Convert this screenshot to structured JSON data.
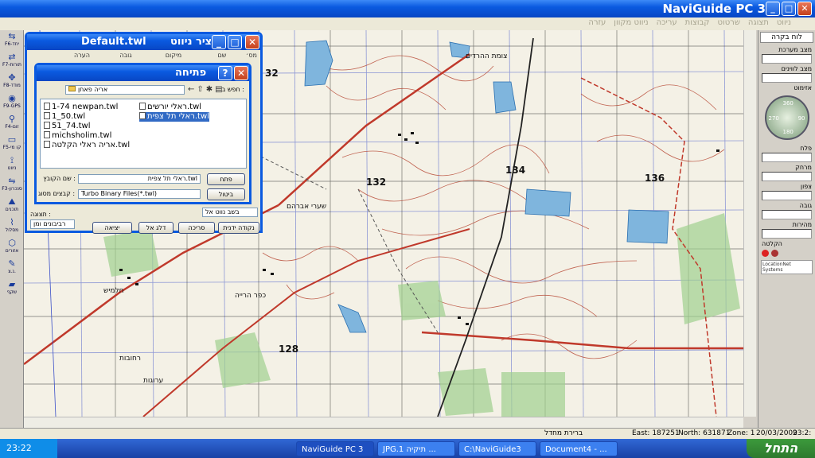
{
  "app": {
    "title": "NaviGuide PC 3"
  },
  "window_buttons": {
    "minimize": "_",
    "maximize": "□",
    "close": "✕"
  },
  "menu": [
    "ניווט",
    "תצוגה",
    "שרטוט",
    "קבוצות",
    "עריכה",
    "ניווט מקוון",
    "עזרה"
  ],
  "left_tools": [
    {
      "label": "F6-יחד",
      "icon": "⇆"
    },
    {
      "label": "F7-תורות",
      "icon": "⇄"
    },
    {
      "label": "F8-מודד",
      "icon": "✥"
    },
    {
      "label": "F9-GPS",
      "icon": "◉"
    },
    {
      "label": "F4-זום",
      "icon": "⚲"
    },
    {
      "label": "F5-קו מי",
      "icon": "▭"
    },
    {
      "label": "ניווט",
      "icon": "⟟"
    },
    {
      "label": "F3-סנכרון",
      "icon": "⇋"
    },
    {
      "label": "תוכנים",
      "icon": "⛰"
    },
    {
      "label": "מסלול",
      "icon": "⌇"
    },
    {
      "label": "אזורים",
      "icon": "⬡"
    },
    {
      "label": "נ.צ.",
      "icon": "✎"
    },
    {
      "label": "שקף",
      "icon": "▰"
    }
  ],
  "right_panel": {
    "header": "לוח בקרה",
    "labels": [
      "מצב מערכת",
      "מצב לווינים",
      "אזימוט",
      "פלח",
      "מרחק",
      "צפון",
      "גובה",
      "מהירות",
      "הקלטה"
    ],
    "compass": {
      "n": "360",
      "e": "90",
      "s": "180",
      "w": "270"
    },
    "logo": "LocationNet Systems"
  },
  "map_labels": [
    "136",
    "134",
    "132",
    "128",
    "32",
    "צומת ההרדים",
    "שערי אברהם",
    "כפר הרייה",
    "חלמיש",
    "ערוגות",
    "רחובות"
  ],
  "default_window": {
    "title": "Default.twl",
    "subtitle": "ציר ניווט",
    "columns": [
      "מס׳",
      "שם",
      "מיקום",
      "גובה",
      "הערה"
    ],
    "footer_label": "תצוגה :",
    "footer_select": "רביבונים ומן",
    "footer_field": "בשב נווט אל",
    "buttons": [
      "יציאה",
      "דלג אל",
      "סריכה",
      "נקודה ידנית"
    ]
  },
  "open_dialog": {
    "title": "פתיחה",
    "help": "?",
    "close": "✕",
    "look_in_label": "חפש ב :",
    "look_in_value": "אריה פאחן",
    "toolbar_icons": [
      "back-icon",
      "up-folder-icon",
      "new-folder-icon",
      "view-menu-icon"
    ],
    "files": [
      "1-74 newpan.twl",
      "1_50.twl",
      "51_74.twl",
      "michsholim.twl",
      "אריה ראלי הקלטה.twl",
      "ראלי יורשים.twl",
      "ראלי תל צפית.twl"
    ],
    "selected_index": 6,
    "filename_label": "שם הקובץ :",
    "filename_value": "ראלי תל צפית.twl",
    "filetype_label": "קבצים מסוג :",
    "filetype_value": "Turbo Binary Files(*.twl)",
    "open_button": "פתח",
    "cancel_button": "ביטול"
  },
  "status": {
    "default_text": "ברירת מחדל",
    "east": "East: 187251",
    "north": "North: 631871",
    "zone": "Zone: 1",
    "date": "20/03/2009",
    "time": "23:2:"
  },
  "taskbar": {
    "start": "התחל",
    "clock": "23:22",
    "tasks": [
      "NaviGuide PC 3",
      "JPG.1 תיקיה ...",
      "C:\\NaviGuide3",
      "Document4 - ..."
    ]
  },
  "colors": {
    "title_blue": "#0a5ae0",
    "map_bg": "#f4f1e6",
    "water": "#7fb5dd",
    "road_red": "#c0392b",
    "contour": "#b5432f"
  }
}
